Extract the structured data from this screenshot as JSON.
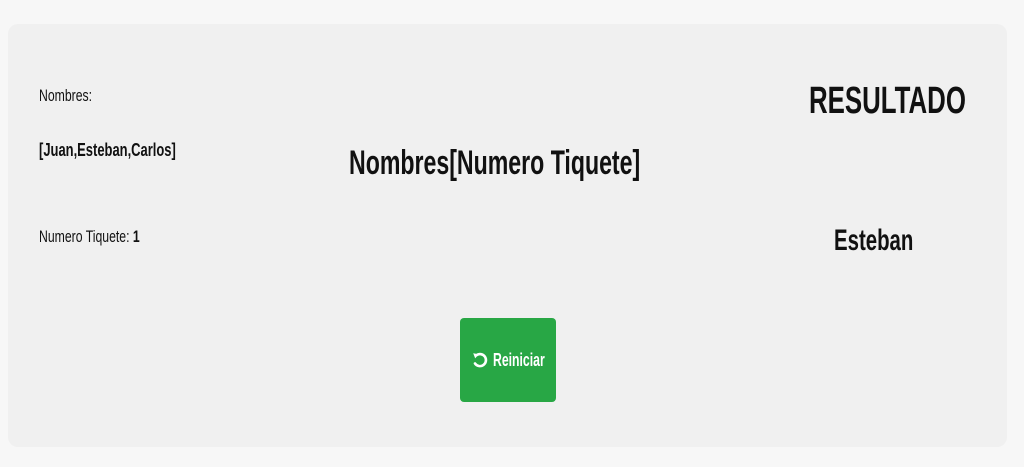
{
  "left_panel": {
    "names_label": "Nombres:",
    "names_list": "[Juan,Esteban,Carlos]",
    "ticket_label": "Numero Tiquete:",
    "ticket_value": "1"
  },
  "center": {
    "title": "Nombres[Numero Tiquete]"
  },
  "result": {
    "heading": "RESULTADO",
    "value": "Esteban"
  },
  "actions": {
    "reset_label": "Reiniciar",
    "reset_icon": "undo-icon",
    "reset_color": "#28a745"
  }
}
